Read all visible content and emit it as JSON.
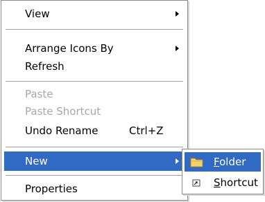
{
  "menu": {
    "view": {
      "label": "View",
      "has_submenu": true
    },
    "arrange": {
      "label": "Arrange Icons By",
      "has_submenu": true
    },
    "refresh": {
      "label": "Refresh"
    },
    "paste": {
      "label": "Paste",
      "enabled": false
    },
    "paste_shortcut": {
      "label": "Paste Shortcut",
      "enabled": false
    },
    "undo_rename": {
      "label": "Undo Rename",
      "shortcut": "Ctrl+Z"
    },
    "new": {
      "label": "New",
      "has_submenu": true,
      "highlighted": true
    },
    "properties": {
      "label": "Properties"
    }
  },
  "submenu": {
    "folder": {
      "mnemonic": "F",
      "rest": "older",
      "icon": "folder-icon",
      "highlighted": true
    },
    "shortcut": {
      "mnemonic": "S",
      "rest": "hortcut",
      "icon": "shortcut-icon"
    }
  },
  "colors": {
    "highlight": "#316ac5",
    "disabled_text": "#a8a8a8",
    "folder_yellow": "#f5d36a"
  }
}
